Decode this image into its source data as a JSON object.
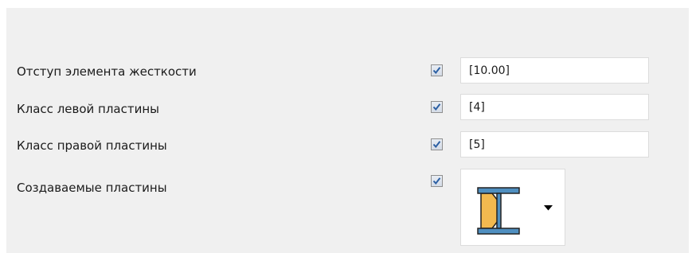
{
  "rows": [
    {
      "label": "Отступ элемента жесткости",
      "checked": true,
      "value": "[10.00]"
    },
    {
      "label": "Класс левой пластины",
      "checked": true,
      "value": "[4]"
    },
    {
      "label": "Класс правой пластины",
      "checked": true,
      "value": "[5]"
    },
    {
      "label": "Создаваемые пластины",
      "checked": true,
      "selected_option_icon": "beam-stiffener-plate-icon"
    }
  ],
  "colors": {
    "panel_background": "#f0f0f0",
    "checkmark": "#2b5fa3",
    "plate_fill": "#f2b94f",
    "beam_fill": "#4f8fc0"
  }
}
